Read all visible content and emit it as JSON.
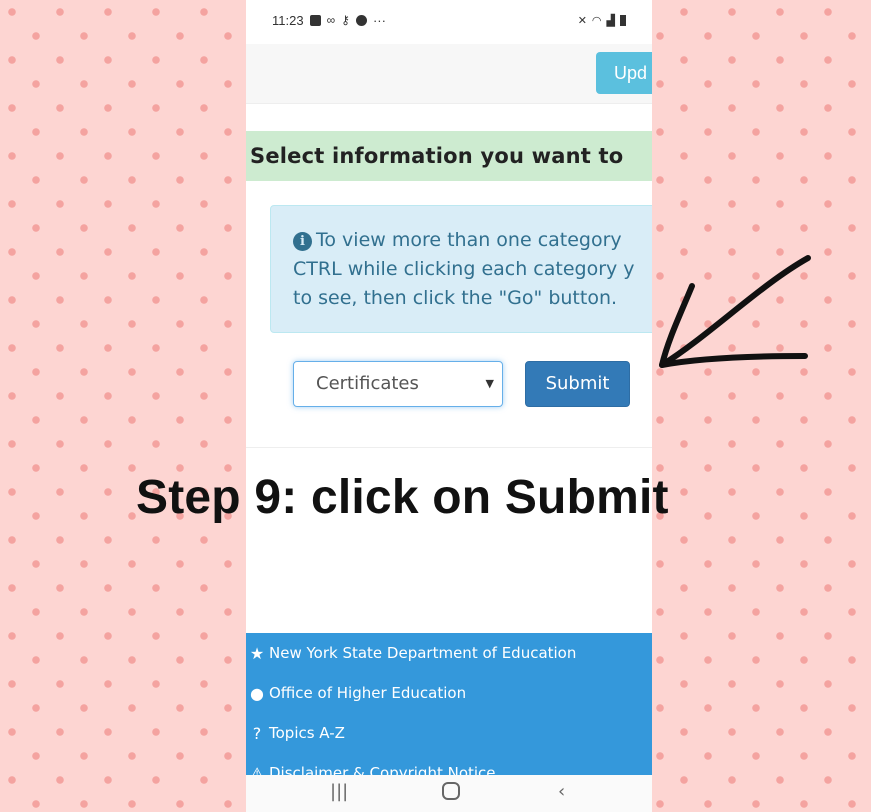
{
  "status_bar": {
    "time": "11:23",
    "left_icons": [
      "facebook-icon",
      "infinity-icon",
      "key-icon",
      "messenger-icon",
      "more-icon"
    ],
    "more_text": "···",
    "right_icons": [
      "mute-icon",
      "wifi-icon",
      "signal-icon",
      "battery-icon"
    ]
  },
  "topbar": {
    "update_label": "Upd"
  },
  "section": {
    "header": "Select information you want to"
  },
  "info": {
    "icon": "info-icon",
    "line1": "To view more than one category",
    "line2": "CTRL while clicking each category y",
    "line3": "to see, then click the \"Go\" button."
  },
  "form": {
    "select_value": "Certificates",
    "submit_label": "Submit"
  },
  "overlay": {
    "caption": "Step 9: click on Submit",
    "arrow_color": "#111111"
  },
  "footer": {
    "items": [
      {
        "icon": "star-icon",
        "label": "New York State Department of Education"
      },
      {
        "icon": "apple-icon",
        "label": "Office of Higher Education"
      },
      {
        "icon": "question-icon",
        "label": "Topics A-Z"
      },
      {
        "icon": "warning-icon",
        "label": "Disclaimer & Copyright Notice"
      }
    ]
  },
  "colors": {
    "background": "#fdd5d2",
    "pattern": "#f4a3a0",
    "header_bg": "#cdebd0",
    "info_bg": "#d9edf7",
    "submit_bg": "#337ab7",
    "update_bg": "#5bc0de",
    "footer_bg": "#3498db"
  }
}
